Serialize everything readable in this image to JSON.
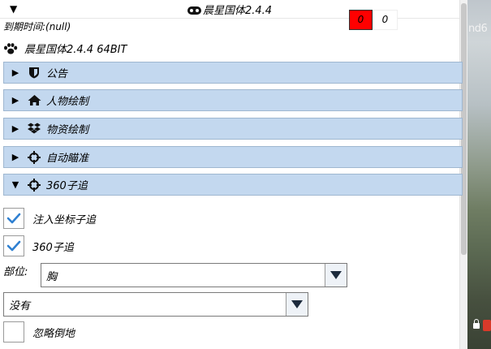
{
  "window": {
    "title": "晨星国体2.4.4",
    "title_icon": "gamepad-icon",
    "collapse_glyph": "▼"
  },
  "counters": {
    "red_value": "0",
    "white_value": "0",
    "red_color": "#ff0000"
  },
  "info": {
    "expire_label": "到期时间:(null)",
    "version_label": "晨星国体2.4.4 64BIT",
    "version_icon": "paw-icon"
  },
  "sections": [
    {
      "label": "公告",
      "icon": "shield-icon",
      "expanded": false,
      "arrow": "▶"
    },
    {
      "label": "人物绘制",
      "icon": "home-icon",
      "expanded": false,
      "arrow": "▶"
    },
    {
      "label": "物资绘制",
      "icon": "dropbox-icon",
      "expanded": false,
      "arrow": "▶"
    },
    {
      "label": "自动瞄准",
      "icon": "crosshair-icon",
      "expanded": false,
      "arrow": "▶"
    },
    {
      "label": "360子追",
      "icon": "crosshair-icon",
      "expanded": true,
      "arrow": "▼"
    }
  ],
  "options": {
    "inject_coord": {
      "label": "注入坐标子追",
      "checked": true
    },
    "track_360": {
      "label": "360子追",
      "checked": true
    },
    "part_label": "部位:",
    "part_value": "胸",
    "second_value": "没有",
    "ignore_down": {
      "label": "忽略倒地",
      "checked": false
    }
  },
  "background": {
    "fragment_text": "nd6"
  },
  "colors": {
    "section_bg": "#c3d8ef",
    "check_blue": "#2f80d1"
  }
}
